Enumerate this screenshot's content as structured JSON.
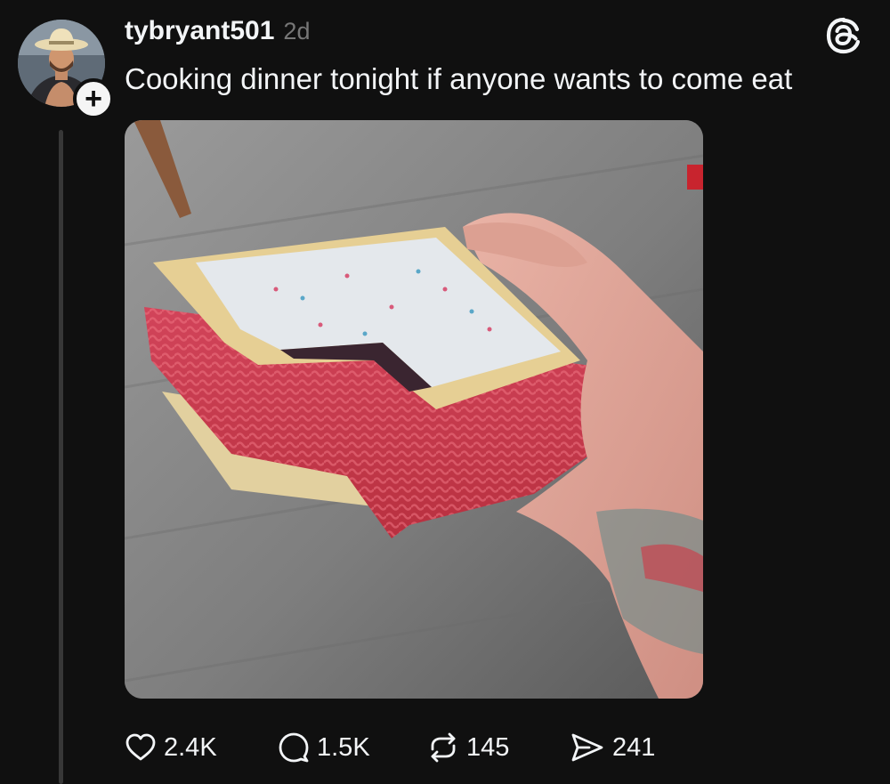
{
  "post": {
    "username": "tybryant501",
    "timestamp": "2d",
    "text": "Cooking dinner tonight if anyone wants to come eat",
    "follow_badge": "+"
  },
  "actions": {
    "likes": "2.4K",
    "replies": "1.5K",
    "reposts": "145",
    "shares": "241"
  },
  "icons": {
    "app_logo": "threads-logo-icon",
    "like": "heart-icon",
    "reply": "speech-bubble-icon",
    "repost": "repost-arrows-icon",
    "share": "send-arrow-icon"
  },
  "colors": {
    "background": "#101010",
    "text": "#f3f5f7",
    "muted": "#777777",
    "thread_line": "#373737"
  }
}
